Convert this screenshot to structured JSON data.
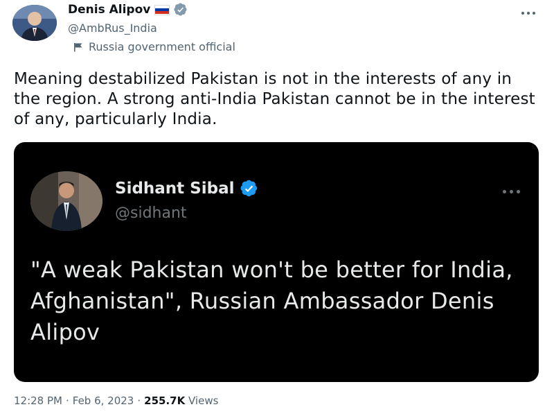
{
  "author": {
    "display_name": "Denis Alipov",
    "handle": "@AmbRus_India",
    "label": "Russia government official",
    "flag_colors": [
      "#ffffff",
      "#0039a6",
      "#d52b1e"
    ]
  },
  "tweet": {
    "text": "Meaning destabilized Pakistan is not in the interests of any in the region. A strong anti-India Pakistan cannot be in the interest of any, particularly India."
  },
  "quoted": {
    "display_name": "Sidhant Sibal",
    "handle": "@sidhant",
    "text": "\"A weak Pakistan won't be better for India, Afghanistan\", Russian Ambassador Denis Alipov"
  },
  "meta": {
    "time": "12:28 PM",
    "separator": "·",
    "date": "Feb 6, 2023",
    "views_count": "255.7K",
    "views_label": "Views"
  },
  "colors": {
    "verified": "#829aab",
    "verified_blue": "#1d9bf0",
    "text_primary": "#0f1419",
    "text_secondary": "#536471",
    "card_background": "#000000"
  },
  "icons": {
    "more": "more-horizontal-icon",
    "verified": "verified-badge-icon",
    "government_label": "flag-pole-icon"
  }
}
